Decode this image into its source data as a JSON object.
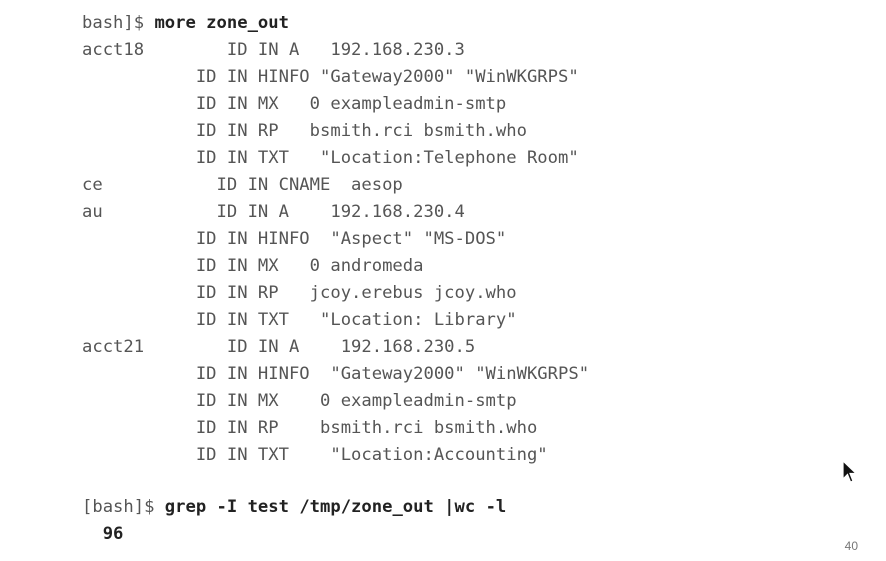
{
  "terminal": {
    "command_1": {
      "prompt": "bash]$ ",
      "text": "more zone_out"
    },
    "zone_lines": [
      "acct18        ID IN A   192.168.230.3",
      "           ID IN HINFO \"Gateway2000\" \"WinWKGRPS\"",
      "           ID IN MX   0 exampleadmin-smtp",
      "           ID IN RP   bsmith.rci bsmith.who",
      "           ID IN TXT   \"Location:Telephone Room\"",
      "ce           ID IN CNAME  aesop",
      "au           ID IN A    192.168.230.4",
      "           ID IN HINFO  \"Aspect\" \"MS-DOS\"",
      "           ID IN MX   0 andromeda",
      "           ID IN RP   jcoy.erebus jcoy.who",
      "           ID IN TXT   \"Location: Library\"",
      "acct21        ID IN A    192.168.230.5",
      "           ID IN HINFO  \"Gateway2000\" \"WinWKGRPS\"",
      "           ID IN MX    0 exampleadmin-smtp",
      "           ID IN RP    bsmith.rci bsmith.who",
      "           ID IN TXT    \"Location:Accounting\""
    ],
    "command_2": {
      "prompt": "[bash]$ ",
      "text": "grep -I test /tmp/zone_out |wc -l"
    },
    "result": "  96"
  },
  "slide": {
    "number": "40"
  },
  "icons": {
    "cursor": "mouse-pointer-icon"
  }
}
